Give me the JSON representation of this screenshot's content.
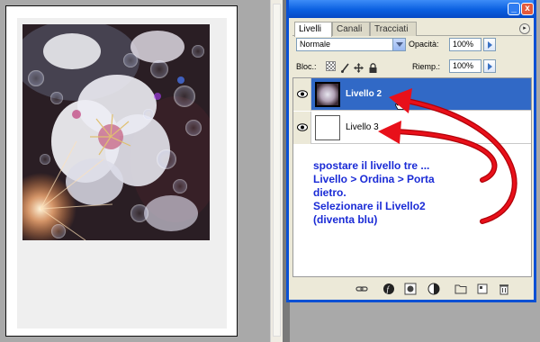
{
  "palette": {
    "tabs": [
      {
        "label": "Livelli",
        "active": true
      },
      {
        "label": "Canali",
        "active": false
      },
      {
        "label": "Tracciati",
        "active": false
      }
    ],
    "blend_mode": "Normale",
    "opacity_label": "Opacità:",
    "opacity_value": "100%",
    "lock_label": "Bloc.:",
    "fill_label": "Riemp.:",
    "fill_value": "100%",
    "window_buttons": {
      "minimize": "_",
      "close": "x"
    },
    "menu_button": "▸"
  },
  "layers": [
    {
      "name": "Livello 2",
      "selected": true,
      "visible": true
    },
    {
      "name": "Livello 3",
      "selected": false,
      "visible": true
    }
  ],
  "instruction": "spostare il livello tre ...\nLivello > Ordina > Porta\ndietro.\nSelezionare il Livello2\n(diventa blu)",
  "colors": {
    "selected_row": "#3169c6",
    "instruction_text": "#1a2bd6",
    "annotation_arrow": "#e8101a",
    "title_bar": "#0a5fe0"
  },
  "icons": {
    "eye": "eye-icon",
    "lock_transparency": "lock-transparency-icon",
    "lock_paint": "brush-icon",
    "lock_move": "move-icon",
    "lock_all": "padlock-icon",
    "cursor": "hand-cursor-icon",
    "bottom_bar": [
      "link-icon",
      "layer-style-icon",
      "mask-icon",
      "adjustment-icon",
      "folder-icon",
      "new-layer-icon",
      "trash-icon"
    ]
  }
}
